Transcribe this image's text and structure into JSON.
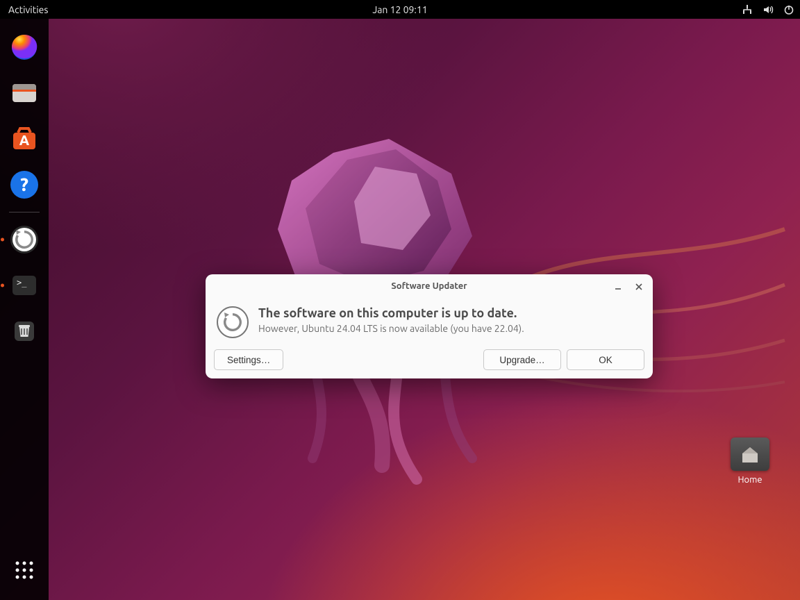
{
  "topbar": {
    "activities": "Activities",
    "clock": "Jan 12  09:11"
  },
  "dock": {
    "items": [
      {
        "name": "firefox",
        "label": "Firefox"
      },
      {
        "name": "files",
        "label": "Files"
      },
      {
        "name": "software-center",
        "label": "Ubuntu Software"
      },
      {
        "name": "help",
        "label": "Help"
      },
      {
        "name": "software-updater",
        "label": "Software Updater"
      },
      {
        "name": "terminal",
        "label": "Terminal"
      },
      {
        "name": "trash",
        "label": "Trash"
      }
    ]
  },
  "desktop": {
    "home_label": "Home"
  },
  "dialog": {
    "title": "Software Updater",
    "heading": "The software on this computer is up to date.",
    "subtext": "However, Ubuntu 24.04 LTS is now available (you have 22.04).",
    "settings_label": "Settings…",
    "upgrade_label": "Upgrade…",
    "ok_label": "OK"
  }
}
